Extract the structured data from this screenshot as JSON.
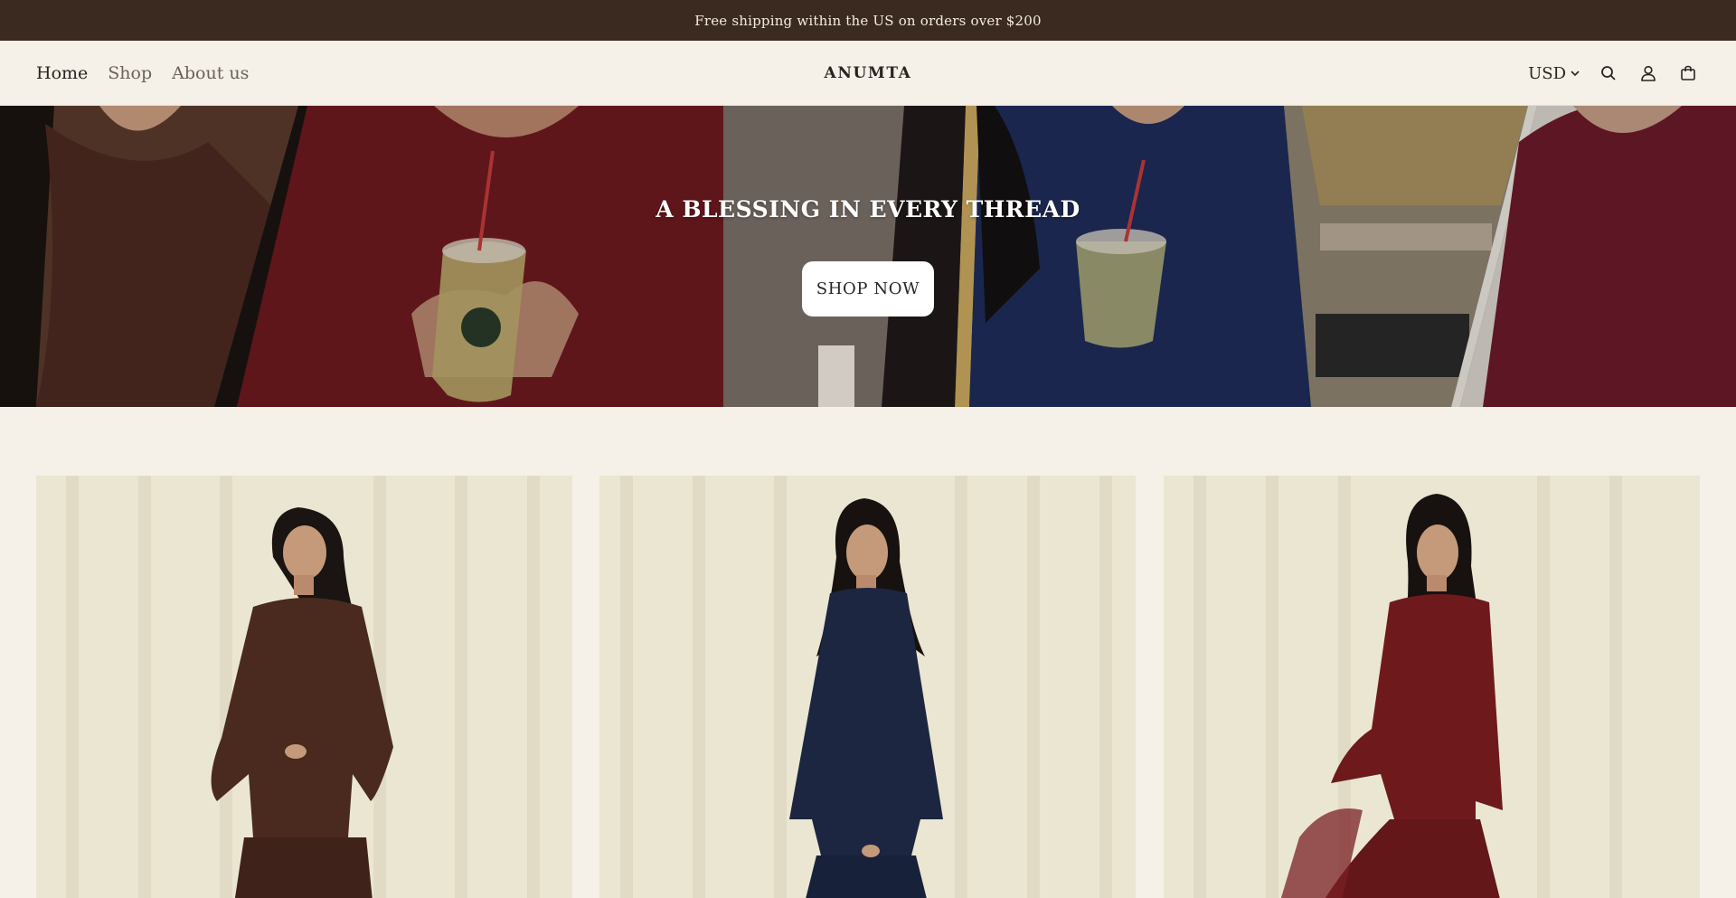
{
  "announcement": {
    "text": "Free shipping within the US on orders over $200"
  },
  "header": {
    "nav": [
      {
        "label": "Home",
        "active": true
      },
      {
        "label": "Shop",
        "active": false
      },
      {
        "label": "About us",
        "active": false
      }
    ],
    "brand": "ANUMTA",
    "currency": "USD",
    "icons": [
      "search-icon",
      "account-icon",
      "cart-icon"
    ]
  },
  "hero": {
    "title": "A BLESSING IN EVERY THREAD",
    "button_label": "SHOP NOW"
  },
  "products": [
    {
      "dress_color": "#4a2a1e"
    },
    {
      "dress_color": "#1c2640"
    },
    {
      "dress_color": "#6e1a1c"
    }
  ],
  "colors": {
    "announcement_bg": "#3b2a1f",
    "page_bg": "#f5f0e8",
    "product_bg": "#ece7d6"
  }
}
